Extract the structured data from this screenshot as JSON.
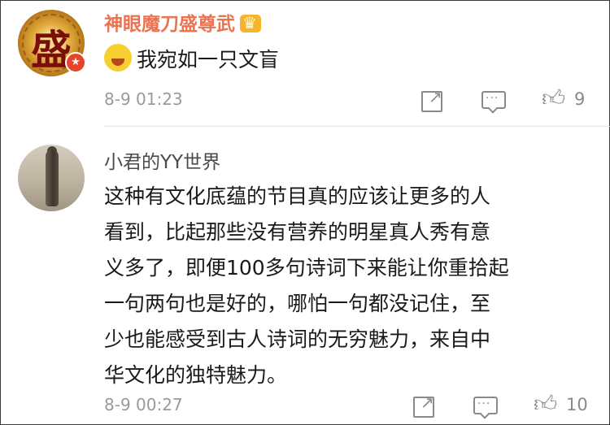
{
  "comments": [
    {
      "user": "神眼魔刀盛尊武",
      "avatar_text": "盛",
      "text": "我宛如一只文盲",
      "emoji": "crying-laughing-emoji",
      "time": "8-9 01:23",
      "likes": "9"
    },
    {
      "user": "小君的YY世界",
      "text_lines": [
        "这种有文化底蕴的节目真的应该让更多的人",
        "看到，比起那些没有营养的明星真人秀有意",
        "义多了，即便100多句诗词下来能让你重拾起",
        "一句两句也是好的，哪怕一句都没记住，至",
        "少也能感受到古人诗词的无穷魅力，来自中",
        "华文化的独特魅力。"
      ],
      "time": "8-9 00:27",
      "likes": "10"
    }
  ],
  "icons": {
    "share": "share-icon",
    "comment": "comment-icon",
    "like": "thumbs-up-icon",
    "vip": "vip-badge-icon",
    "crown": "crown-icon"
  },
  "colors": {
    "vip_name": "#eb7350",
    "muted": "#9a9a9a",
    "text": "#1a1a1a"
  }
}
